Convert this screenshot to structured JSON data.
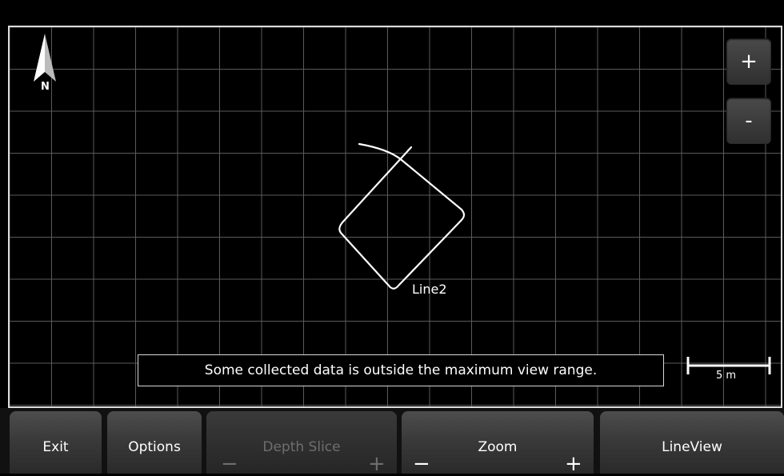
{
  "map": {
    "north_label": "N",
    "line_label": "Line2",
    "message": "Some collected data is outside the maximum view range.",
    "scale_label": "5 m",
    "zoom_in_label": "+",
    "zoom_out_label": "-",
    "colors": {
      "background": "#000000",
      "grid": "#5a5a5a",
      "path": "#ffffff"
    }
  },
  "toolbar": {
    "exit_label": "Exit",
    "options_label": "Options",
    "depth_slice": {
      "label": "Depth Slice",
      "minus": "−",
      "plus": "+"
    },
    "zoom": {
      "label": "Zoom",
      "minus": "−",
      "plus": "+"
    },
    "lineview_label": "LineView"
  }
}
